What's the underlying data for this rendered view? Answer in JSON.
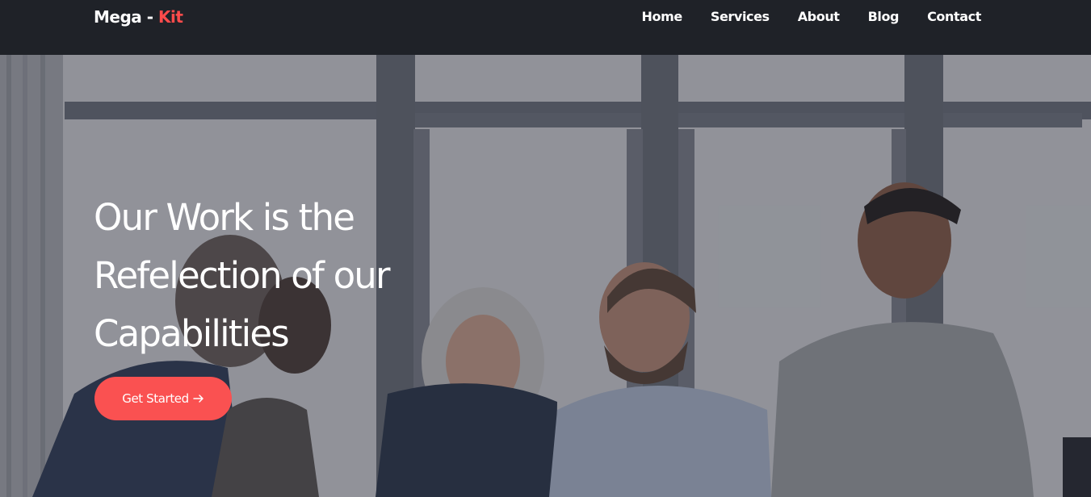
{
  "brand": {
    "name": "Mega - ",
    "accent": "Kit"
  },
  "nav": {
    "items": [
      {
        "label": "Home"
      },
      {
        "label": "Services"
      },
      {
        "label": "About"
      },
      {
        "label": "Blog"
      },
      {
        "label": "Contact"
      }
    ]
  },
  "hero": {
    "title_lines": [
      "Our Work is the",
      "Refelection of our",
      "Capabilities"
    ],
    "cta_label": "Get Started",
    "cta_icon": "arrow-right-icon"
  },
  "colors": {
    "navbar_bg": "#1f2228",
    "accent": "#ff4b4b",
    "cta_bg": "#fa5151",
    "text_light": "#ffffff"
  }
}
